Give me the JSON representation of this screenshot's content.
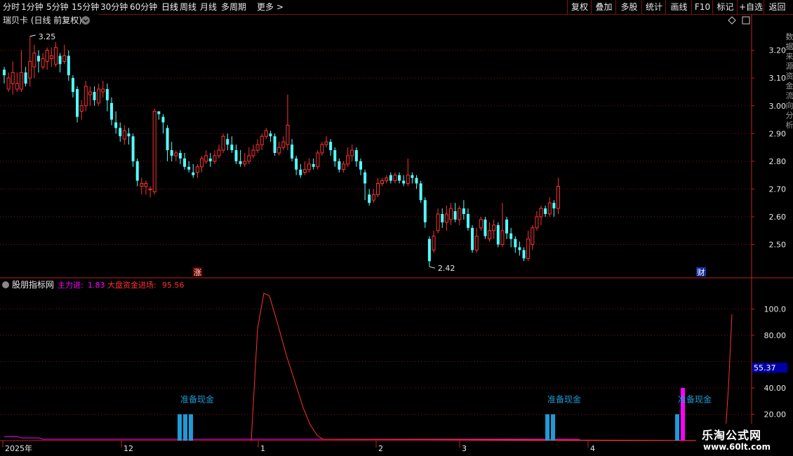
{
  "toolbar": {
    "periods": [
      "分时",
      "1分钟",
      "5分钟",
      "15分钟",
      "30分钟",
      "60分钟",
      "日线",
      "周线",
      "月线",
      "多周期",
      "更多 >"
    ],
    "active": "日线",
    "right": [
      "复权",
      "叠加",
      "多股",
      "统计",
      "画线",
      "F10",
      "标记",
      "+自选",
      "返回"
    ]
  },
  "main": {
    "title": "瑞贝卡 (日线 前复权)",
    "high_label": "3.25",
    "low_label": "2.42",
    "zhang": "涨",
    "cai": "财",
    "y_ticks": [
      "3.20",
      "3.10",
      "3.00",
      "2.90",
      "2.80",
      "2.70",
      "2.60",
      "2.50"
    ]
  },
  "indicator": {
    "name": "股朋指标网",
    "zlj_label": "主力进:",
    "zlj_value": "1.83",
    "dp_label": "大盘资金进场:",
    "dp_value": "95.56",
    "y_ticks": [
      "100.0",
      "80.00",
      "40.00",
      "20.00"
    ],
    "current_value": "55.37",
    "signal_text": "准备现金"
  },
  "x_axis": [
    "2025年",
    "12",
    "1",
    "2",
    "3",
    "4"
  ],
  "right_edge_text": "数据来源资金流向分析",
  "logo": {
    "line1": "乐淘公式网",
    "line2": "www.60lt.com"
  },
  "colors": {
    "up": "#ff3232",
    "down": "#54ffff",
    "grid": "#8a0f0f",
    "axis": "#c02020",
    "magenta": "#ff00ff",
    "bar": "#1f9ad6",
    "label": "#e8e8e8"
  },
  "chart_data": {
    "type": "candlestick",
    "price_ylim": [
      2.38,
      3.28
    ],
    "candles": [
      [
        3.13,
        3.11,
        3.14,
        3.08
      ],
      [
        3.06,
        3.1,
        3.12,
        3.05
      ],
      [
        3.08,
        3.12,
        3.16,
        3.04
      ],
      [
        3.06,
        3.08,
        3.12,
        3.05
      ],
      [
        3.06,
        3.12,
        3.2,
        3.05
      ],
      [
        3.12,
        3.08,
        3.14,
        3.07
      ],
      [
        3.1,
        3.16,
        3.25,
        3.07
      ],
      [
        3.14,
        3.19,
        3.22,
        3.1
      ],
      [
        3.18,
        3.16,
        3.2,
        3.12
      ],
      [
        3.14,
        3.17,
        3.19,
        3.13
      ],
      [
        3.16,
        3.2,
        3.21,
        3.13
      ],
      [
        3.17,
        3.18,
        3.21,
        3.14
      ],
      [
        3.15,
        3.21,
        3.23,
        3.14
      ],
      [
        3.18,
        3.15,
        3.19,
        3.12
      ],
      [
        3.16,
        3.18,
        3.22,
        3.15
      ],
      [
        3.18,
        3.11,
        3.2,
        3.09
      ],
      [
        3.1,
        3.05,
        3.11,
        3.03
      ],
      [
        3.06,
        2.96,
        3.07,
        2.94
      ],
      [
        2.98,
        3.0,
        3.02,
        2.95
      ],
      [
        3.0,
        3.07,
        3.09,
        2.98
      ],
      [
        3.04,
        3.05,
        3.07,
        3.0
      ],
      [
        3.05,
        3.02,
        3.07,
        3.0
      ],
      [
        3.01,
        3.06,
        3.08,
        3.0
      ],
      [
        3.05,
        3.06,
        3.09,
        3.03
      ],
      [
        3.06,
        3.02,
        3.08,
        2.98
      ],
      [
        3.01,
        2.95,
        3.03,
        2.93
      ],
      [
        2.94,
        2.92,
        2.98,
        2.9
      ],
      [
        2.92,
        2.89,
        2.94,
        2.87
      ],
      [
        2.88,
        2.91,
        2.93,
        2.86
      ],
      [
        2.9,
        2.89,
        2.92,
        2.86
      ],
      [
        2.89,
        2.8,
        2.9,
        2.78
      ],
      [
        2.8,
        2.73,
        2.81,
        2.71
      ],
      [
        2.71,
        2.72,
        2.74,
        2.68
      ],
      [
        2.71,
        2.72,
        2.73,
        2.68
      ],
      [
        2.7,
        2.7,
        2.71,
        2.67
      ],
      [
        2.69,
        2.98,
        2.99,
        2.68
      ],
      [
        2.98,
        2.97,
        2.98,
        2.95
      ],
      [
        2.96,
        2.94,
        2.97,
        2.9
      ],
      [
        2.92,
        2.84,
        2.93,
        2.8
      ],
      [
        2.84,
        2.82,
        2.87,
        2.8
      ],
      [
        2.82,
        2.83,
        2.84,
        2.8
      ],
      [
        2.83,
        2.81,
        2.84,
        2.79
      ],
      [
        2.81,
        2.78,
        2.83,
        2.77
      ],
      [
        2.78,
        2.77,
        2.8,
        2.76
      ],
      [
        2.76,
        2.75,
        2.79,
        2.74
      ],
      [
        2.76,
        2.78,
        2.79,
        2.74
      ],
      [
        2.78,
        2.81,
        2.82,
        2.76
      ],
      [
        2.8,
        2.82,
        2.84,
        2.79
      ],
      [
        2.81,
        2.8,
        2.83,
        2.78
      ],
      [
        2.8,
        2.82,
        2.84,
        2.79
      ],
      [
        2.82,
        2.84,
        2.86,
        2.81
      ],
      [
        2.84,
        2.89,
        2.9,
        2.83
      ],
      [
        2.88,
        2.86,
        2.9,
        2.84
      ],
      [
        2.86,
        2.84,
        2.89,
        2.83
      ],
      [
        2.84,
        2.8,
        2.86,
        2.79
      ],
      [
        2.8,
        2.79,
        2.84,
        2.78
      ],
      [
        2.79,
        2.8,
        2.83,
        2.78
      ],
      [
        2.8,
        2.82,
        2.85,
        2.79
      ],
      [
        2.82,
        2.84,
        2.86,
        2.81
      ],
      [
        2.84,
        2.86,
        2.88,
        2.83
      ],
      [
        2.86,
        2.89,
        2.9,
        2.84
      ],
      [
        2.89,
        2.91,
        2.92,
        2.88
      ],
      [
        2.9,
        2.89,
        2.91,
        2.87
      ],
      [
        2.89,
        2.83,
        2.9,
        2.82
      ],
      [
        2.83,
        2.85,
        2.87,
        2.82
      ],
      [
        2.85,
        2.87,
        2.89,
        2.84
      ],
      [
        2.86,
        2.93,
        3.04,
        2.84
      ],
      [
        2.86,
        2.81,
        2.88,
        2.8
      ],
      [
        2.81,
        2.77,
        2.82,
        2.75
      ],
      [
        2.77,
        2.75,
        2.79,
        2.74
      ],
      [
        2.76,
        2.77,
        2.8,
        2.75
      ],
      [
        2.77,
        2.79,
        2.81,
        2.76
      ],
      [
        2.79,
        2.78,
        2.81,
        2.77
      ],
      [
        2.78,
        2.83,
        2.84,
        2.77
      ],
      [
        2.83,
        2.86,
        2.87,
        2.82
      ],
      [
        2.86,
        2.87,
        2.89,
        2.85
      ],
      [
        2.87,
        2.84,
        2.88,
        2.82
      ],
      [
        2.84,
        2.8,
        2.85,
        2.78
      ],
      [
        2.8,
        2.77,
        2.81,
        2.76
      ],
      [
        2.77,
        2.79,
        2.8,
        2.76
      ],
      [
        2.79,
        2.82,
        2.85,
        2.78
      ],
      [
        2.82,
        2.84,
        2.86,
        2.8
      ],
      [
        2.84,
        2.8,
        2.85,
        2.78
      ],
      [
        2.8,
        2.77,
        2.81,
        2.75
      ],
      [
        2.76,
        2.72,
        2.77,
        2.66
      ],
      [
        2.68,
        2.65,
        2.7,
        2.64
      ],
      [
        2.66,
        2.68,
        2.7,
        2.65
      ],
      [
        2.68,
        2.72,
        2.74,
        2.67
      ],
      [
        2.72,
        2.73,
        2.74,
        2.71
      ],
      [
        2.73,
        2.74,
        2.75,
        2.72
      ],
      [
        2.75,
        2.73,
        2.76,
        2.72
      ],
      [
        2.73,
        2.75,
        2.76,
        2.72
      ],
      [
        2.75,
        2.73,
        2.76,
        2.72
      ],
      [
        2.73,
        2.72,
        2.75,
        2.71
      ],
      [
        2.72,
        2.75,
        2.81,
        2.71
      ],
      [
        2.75,
        2.74,
        2.76,
        2.72
      ],
      [
        2.74,
        2.72,
        2.75,
        2.7
      ],
      [
        2.72,
        2.66,
        2.73,
        2.65
      ],
      [
        2.66,
        2.58,
        2.67,
        2.56
      ],
      [
        2.52,
        2.44,
        2.53,
        2.42
      ],
      [
        2.48,
        2.53,
        2.55,
        2.47
      ],
      [
        2.55,
        2.61,
        2.63,
        2.54
      ],
      [
        2.61,
        2.58,
        2.63,
        2.56
      ],
      [
        2.58,
        2.61,
        2.64,
        2.55
      ],
      [
        2.59,
        2.63,
        2.65,
        2.57
      ],
      [
        2.62,
        2.59,
        2.65,
        2.58
      ],
      [
        2.59,
        2.63,
        2.64,
        2.57
      ],
      [
        2.63,
        2.61,
        2.66,
        2.59
      ],
      [
        2.61,
        2.56,
        2.63,
        2.55
      ],
      [
        2.56,
        2.48,
        2.57,
        2.47
      ],
      [
        2.48,
        2.53,
        2.56,
        2.47
      ],
      [
        2.56,
        2.59,
        2.6,
        2.55
      ],
      [
        2.59,
        2.53,
        2.6,
        2.52
      ],
      [
        2.52,
        2.55,
        2.58,
        2.51
      ],
      [
        2.55,
        2.57,
        2.59,
        2.52
      ],
      [
        2.57,
        2.5,
        2.58,
        2.49
      ],
      [
        2.5,
        2.55,
        2.65,
        2.49
      ],
      [
        2.59,
        2.54,
        2.6,
        2.52
      ],
      [
        2.54,
        2.52,
        2.56,
        2.49
      ],
      [
        2.52,
        2.49,
        2.53,
        2.47
      ],
      [
        2.49,
        2.48,
        2.51,
        2.46
      ],
      [
        2.48,
        2.45,
        2.49,
        2.44
      ],
      [
        2.45,
        2.52,
        2.55,
        2.44
      ],
      [
        2.5,
        2.56,
        2.57,
        2.48
      ],
      [
        2.56,
        2.6,
        2.62,
        2.55
      ],
      [
        2.6,
        2.63,
        2.64,
        2.57
      ],
      [
        2.63,
        2.61,
        2.64,
        2.6
      ],
      [
        2.61,
        2.65,
        2.67,
        2.6
      ],
      [
        2.65,
        2.63,
        2.66,
        2.6
      ],
      [
        2.63,
        2.71,
        2.74,
        2.61
      ]
    ],
    "indicator_ylim": [
      0,
      120
    ],
    "magenta_line": [
      3,
      3,
      3,
      3,
      2,
      2,
      2,
      2,
      2,
      1,
      1,
      1,
      1,
      1,
      1,
      1,
      1,
      1,
      1,
      1,
      1,
      1,
      1,
      1,
      1,
      1,
      1,
      1,
      1,
      1,
      1,
      1,
      1,
      1,
      1,
      1,
      1,
      1,
      1,
      1,
      1,
      1,
      1,
      1,
      1,
      1,
      1,
      1,
      1,
      1,
      1,
      1,
      1,
      1,
      1,
      1,
      1,
      1,
      1,
      1,
      1,
      1,
      1,
      1,
      1,
      1,
      1,
      1,
      1,
      1,
      1,
      1,
      1,
      1,
      1,
      1,
      1,
      1,
      1,
      1,
      1,
      1,
      1,
      1,
      1,
      1,
      1,
      1,
      1,
      1,
      1,
      1,
      1,
      1,
      1,
      1,
      1,
      1,
      1,
      1,
      1,
      1,
      1,
      1,
      1,
      1,
      1,
      1,
      1,
      1,
      1,
      1,
      1,
      1,
      1,
      1,
      1,
      1,
      1,
      1,
      1,
      1,
      1,
      1,
      1,
      1,
      1,
      1,
      1,
      1,
      1,
      1,
      1,
      1,
      1
    ],
    "red_curve": [
      [
        358,
        0
      ],
      [
        367,
        85
      ],
      [
        376,
        112
      ],
      [
        384,
        110
      ],
      [
        395,
        90
      ],
      [
        408,
        65
      ],
      [
        420,
        45
      ],
      [
        432,
        25
      ],
      [
        442,
        12
      ],
      [
        452,
        4
      ],
      [
        460,
        1
      ],
      [
        1033,
        0
      ],
      [
        1038,
        40
      ],
      [
        1043,
        96
      ]
    ],
    "blue_bars": [
      {
        "x": [
          256,
          264,
          272
        ],
        "height": 20
      },
      {
        "x": [
          780,
          788
        ],
        "height": 20
      },
      {
        "x": [
          965
        ],
        "height": 20
      }
    ],
    "magenta_bar": {
      "x": 973,
      "height": 40
    },
    "signal_label_x": [
      281,
      804,
      990
    ]
  }
}
